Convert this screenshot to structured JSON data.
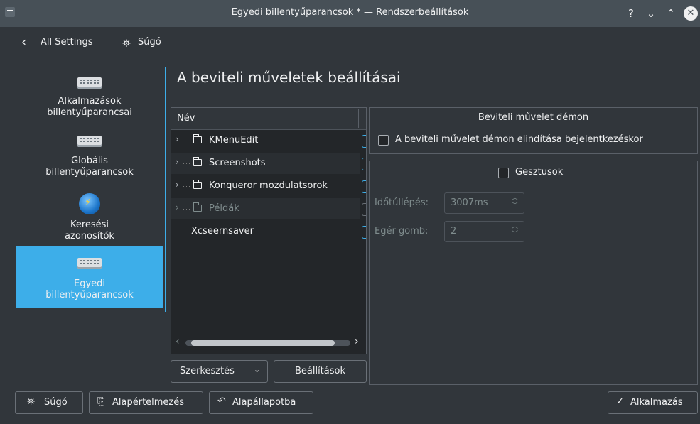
{
  "window": {
    "title": "Egyedi billentyűparancsok * — Rendszerbeállítások",
    "controls": {
      "help": "?",
      "minimize": "⌄",
      "maximize": "⌃",
      "close": "✕"
    }
  },
  "nav": {
    "back_label": "All Settings",
    "help_label": "Súgó"
  },
  "sidebar": {
    "items": [
      {
        "label": "Alkalmazások\nbillentyűparancsai",
        "icon": "keyboard-icon"
      },
      {
        "label": "Globális\nbillentyűparancsok",
        "icon": "keyboard-icon"
      },
      {
        "label": "Keresési\nazonosítók",
        "icon": "globe-icon"
      },
      {
        "label": "Egyedi\nbillentyűparancsok",
        "icon": "keyboard-icon",
        "selected": true
      }
    ]
  },
  "page": {
    "title": "A beviteli műveletek beállításai"
  },
  "tree": {
    "header": "Név",
    "rows": [
      {
        "label": "KMenuEdit",
        "folder": true
      },
      {
        "label": "Screenshots",
        "folder": true
      },
      {
        "label": "Konqueror mozdulatsorok",
        "folder": true
      },
      {
        "label": "Példák",
        "folder": true,
        "disabled": true
      },
      {
        "label": "Xcseernsaver",
        "folder": false
      }
    ]
  },
  "buttons": {
    "edit": "Szerkesztés",
    "settings": "Beállítások"
  },
  "daemon": {
    "title": "Beviteli művelet démon",
    "autostart_label": "A beviteli művelet démon elindítása bejelentkezéskor"
  },
  "gestures": {
    "label": "Gesztusok",
    "timeout_label": "Időtúllépés:",
    "timeout_value": "3007ms",
    "mouse_button_label": "Egér gomb:",
    "mouse_button_value": "2"
  },
  "footer": {
    "help": "Súgó",
    "defaults": "Alapértelmezés",
    "reset": "Alapállapotba",
    "apply": "Alkalmazás"
  },
  "colors": {
    "accent": "#3daee9",
    "background": "#31363b",
    "titlebar": "#475057"
  }
}
